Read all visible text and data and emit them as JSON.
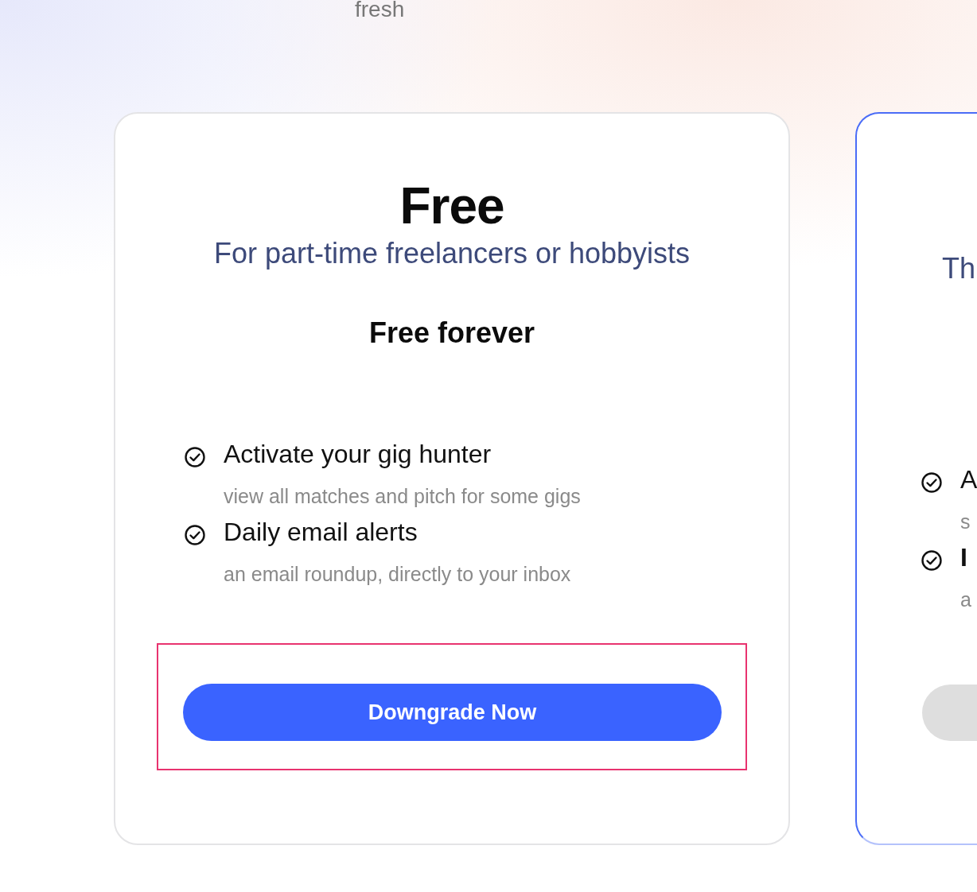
{
  "heading_fragment": "fresh",
  "plans": [
    {
      "kind": "full",
      "highlighted": false,
      "title": "Free",
      "subtitle": "For part-time freelancers or hobbyists",
      "price": "Free forever",
      "features": [
        {
          "title": "Activate your gig hunter",
          "bold": false,
          "detail": "view all matches and pitch for some gigs"
        },
        {
          "title": "Daily email alerts",
          "bold": false,
          "detail": "an email roundup, directly to your inbox"
        }
      ],
      "button": {
        "label": "Downgrade Now",
        "kind": "primary",
        "outlined": true
      }
    },
    {
      "kind": "partial",
      "highlighted": true,
      "subtitle": "Th",
      "features": [
        {
          "title": "A",
          "bold": false,
          "detail": "s"
        },
        {
          "title": "I",
          "bold": true,
          "detail": "a"
        }
      ],
      "button": {
        "kind": "muted",
        "outlined": false
      }
    }
  ]
}
